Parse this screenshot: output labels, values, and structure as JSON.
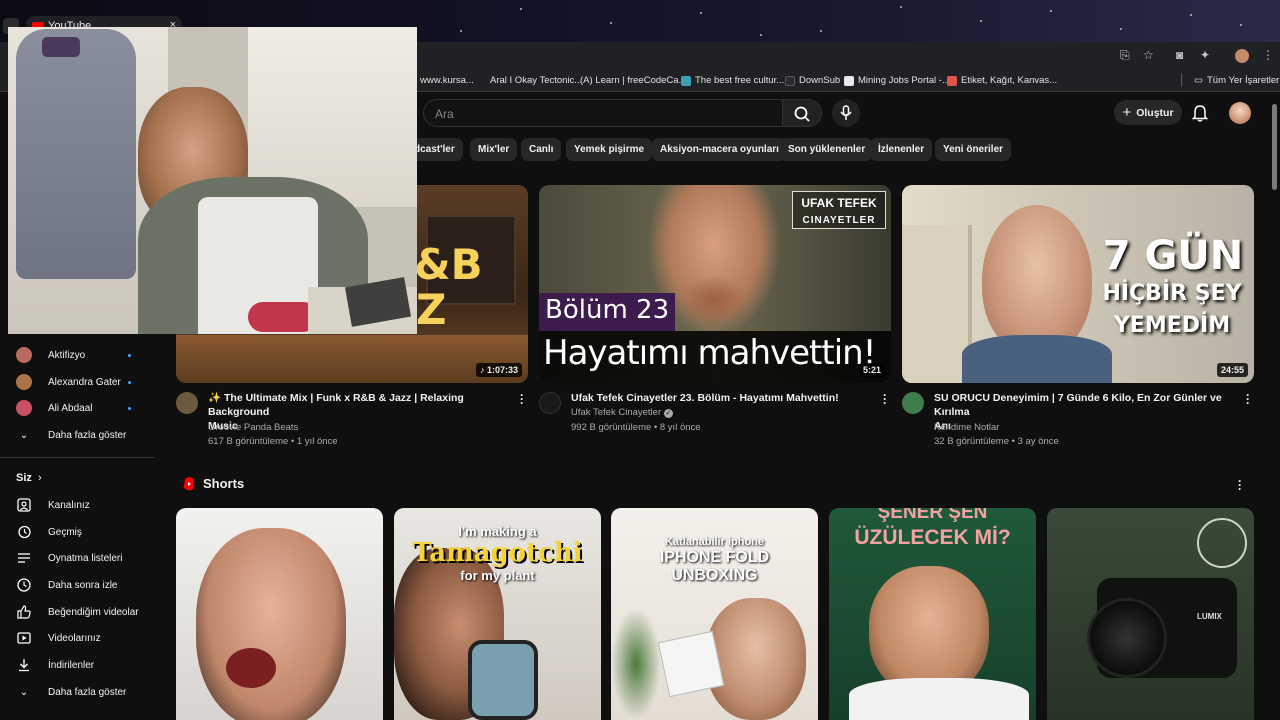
{
  "browser": {
    "tab_title": "YouTube",
    "bookmarks": [
      {
        "label": "www.kursa...",
        "color": "#5b7fd6"
      },
      {
        "label": "Aral I Okay Tectonic...",
        "color": "#888888"
      },
      {
        "label": "(A) Learn | freeCodeCa...",
        "color": "#0a0a23"
      },
      {
        "label": "The best free cultur...",
        "color": "#3aa0b5"
      },
      {
        "label": "DownSub",
        "color": "#2c2c2c"
      },
      {
        "label": "Mining Jobs Portal -...",
        "color": "#e8e8e8"
      },
      {
        "label": "Etiket, Kağıt, Kanvas...",
        "color": "#e0534a"
      },
      {
        "label": "Tüm Yer İşaretleri",
        "color": "#c8c8c8"
      }
    ]
  },
  "masthead": {
    "search_placeholder": "Ara",
    "create_label": "Oluştur"
  },
  "chips": [
    "dcast'ler",
    "Mix'ler",
    "Canlı",
    "Yemek pişirme",
    "Aksiyon-macera oyunları",
    "Son yüklenenler",
    "İzlenenler",
    "Yeni öneriler"
  ],
  "sidebar": {
    "subscriptions": [
      {
        "label": "Aktifizyo",
        "color": "#b86a5f"
      },
      {
        "label": "Alexandra Gater",
        "color": "#a9744a"
      },
      {
        "label": "Ali Abdaal",
        "color": "#c85060"
      }
    ],
    "show_more": "Daha fazla göster",
    "you_header": "Siz",
    "you_items": [
      {
        "label": "Kanalınız",
        "icon": "user-icon"
      },
      {
        "label": "Geçmiş",
        "icon": "history-icon"
      },
      {
        "label": "Oynatma listeleri",
        "icon": "playlist-icon"
      },
      {
        "label": "Daha sonra izle",
        "icon": "clock-icon"
      },
      {
        "label": "Beğendiğim videolar",
        "icon": "thumbs-up-icon"
      },
      {
        "label": "Videolarınız",
        "icon": "video-icon"
      },
      {
        "label": "İndirilenler",
        "icon": "download-icon"
      }
    ],
    "show_more_2": "Daha fazla göster"
  },
  "videos": [
    {
      "title_line1": "✨ The Ultimate Mix | Funk x R&B & Jazz | Relaxing Background",
      "title_line2": "Music",
      "channel": "Groovie Panda Beats",
      "meta": "617 B görüntüleme • 1 yıl önce",
      "duration": "1:07:33",
      "thumb_text_1": "&B",
      "thumb_text_2": "Z",
      "avatar_color": "#6b5a40"
    },
    {
      "title_line1": "Ufak Tefek Cinayetler 23. Bölüm - Hayatımı Mahvettin!",
      "title_line2": "",
      "channel": "Ufak Tefek Cinayetler",
      "meta": "992 B görüntüleme • 8 yıl önce",
      "duration": "5:21",
      "thumb_logo_1": "UFAK TEFEK",
      "thumb_logo_2": "CINAYETLER",
      "thumb_episode": "Bölüm 23",
      "thumb_caption": "Hayatımı mahvettin!",
      "avatar_color": "#1a1a1a"
    },
    {
      "title_line1": "SU ORUCU Deneyimim | 7 Günde 6 Kilo, En Zor Günler ve Kırılma",
      "title_line2": "Anı",
      "channel": "Kendime Notlar",
      "meta": "32 B görüntüleme • 3 ay önce",
      "duration": "24:55",
      "thumb_text_1": "7 GÜN",
      "thumb_text_2": "HİÇBİR ŞEY",
      "thumb_text_3": "YEMEDİM",
      "avatar_color": "#3f7d4f"
    }
  ],
  "shorts": {
    "header": "Shorts",
    "items": [
      {
        "caption": ""
      },
      {
        "caption_1": "I'm making a",
        "caption_2": "Tamagotchi",
        "caption_3": "for my plant"
      },
      {
        "caption_1": "Katlanabilir iphone",
        "caption_2": "IPHONE FOLD",
        "caption_3": "UNBOXING"
      },
      {
        "caption_1": "ŞENER ŞEN",
        "caption_2": "ÜZÜLECEK Mİ?"
      },
      {
        "caption_1": "LUMIX"
      }
    ]
  }
}
